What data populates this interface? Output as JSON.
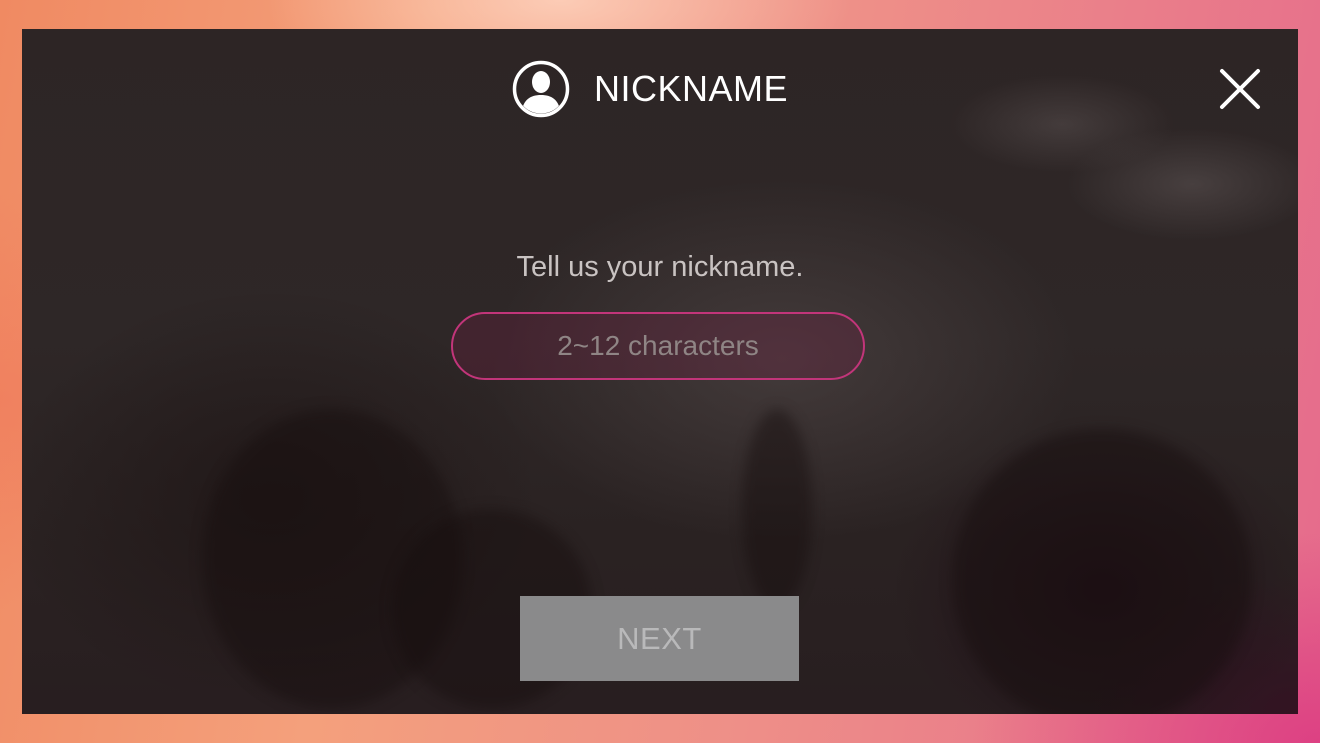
{
  "header": {
    "icon": "user-avatar-icon",
    "title": "NICKNAME",
    "close_icon": "close-icon"
  },
  "form": {
    "prompt": "Tell us your nickname.",
    "nickname_input": {
      "value": "",
      "placeholder": "2~12 characters"
    },
    "next_label": "NEXT"
  },
  "colors": {
    "input_border": "#c2357a",
    "next_button_bg": "#8a8a8b",
    "title_text": "#ffffff",
    "prompt_text": "#c9c3c2"
  }
}
